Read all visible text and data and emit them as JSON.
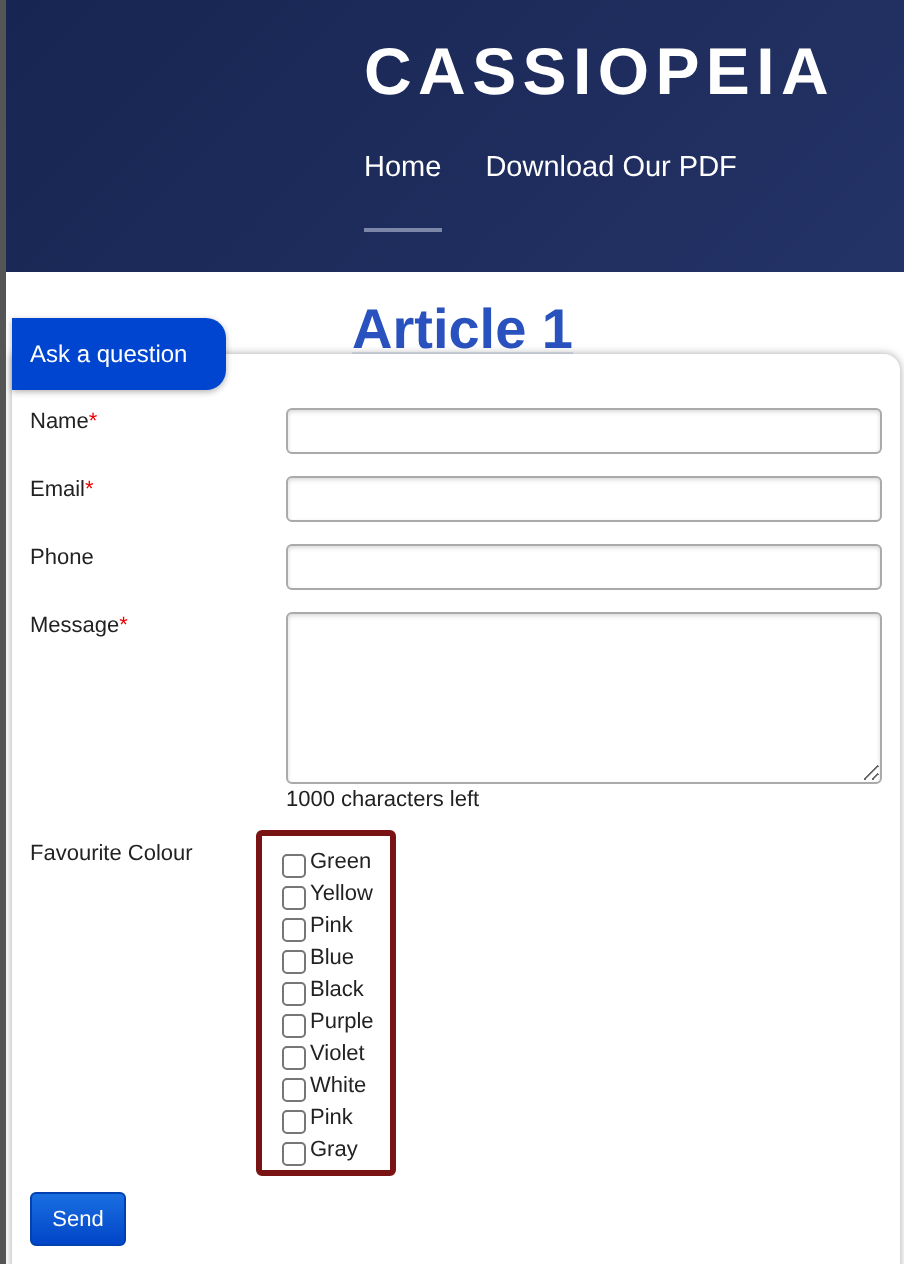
{
  "header": {
    "logo": "CASSIOPEIA",
    "nav": [
      {
        "label": "Home",
        "selected": true
      },
      {
        "label": "Download Our PDF",
        "selected": false
      }
    ]
  },
  "article": {
    "title": "Article 1"
  },
  "form": {
    "tab": "Ask a question",
    "fields": [
      {
        "label": "Name",
        "required_mark": "*",
        "kind": "text"
      },
      {
        "label": "Email",
        "required_mark": "*",
        "kind": "text"
      },
      {
        "label": "Phone",
        "kind": "text"
      },
      {
        "label": "Message",
        "required_mark": "*",
        "kind": "textarea"
      }
    ],
    "counter": "1000 characters left",
    "colour_label": "Favourite Colour",
    "options": [
      {
        "label": "Green",
        "checked": false
      },
      {
        "label": "Yellow",
        "checked": false
      },
      {
        "label": "Pink",
        "checked": false
      },
      {
        "label": "Blue",
        "checked": false
      },
      {
        "label": "Black",
        "checked": false
      },
      {
        "label": "Purple",
        "checked": false
      },
      {
        "label": "Violet",
        "checked": false
      },
      {
        "label": "White",
        "checked": false
      },
      {
        "label": "Pink",
        "checked": false
      },
      {
        "label": "Gray",
        "checked": false
      }
    ],
    "send": "Send"
  }
}
